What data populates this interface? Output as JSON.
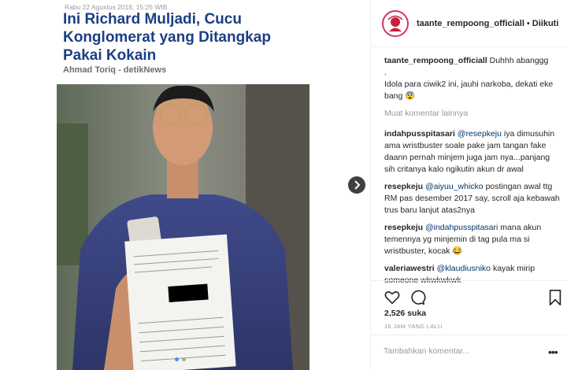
{
  "news": {
    "date": "Rabu 22 Agustus 2018, 15:25 WIB",
    "title": "Ini Richard Muljadi, Cucu Konglomerat yang Ditangkap Pakai Kokain",
    "author": "Ahmad Toriq - detikNews"
  },
  "post": {
    "username": "taante_rempoong_officiall",
    "separator": "•",
    "follow_status": "Diikuti"
  },
  "caption": {
    "user": "taante_rempoong_officiall",
    "lines": [
      "Duhhh abanggg",
      ".",
      "Idola para ciwik2 ini, jauhi narkoba, dekati eke bang 😨"
    ]
  },
  "load_more": "Muat komentar lainnya",
  "comments": [
    {
      "user": "indahpusspitasari",
      "mention": "@resepkeju",
      "text": "iya dimusuhin ama wristbuster soale pake jam tangan fake daann pernah minjem juga jam nya...panjang sih critanya kalo ngikutin akun dr awal"
    },
    {
      "user": "resepkeju",
      "mention": "@aiyuu_whicko",
      "text": "postingan awal ttg RM pas desember 2017 say, scroll aja kebawah trus baru lanjut atas2nya"
    },
    {
      "user": "resepkeju",
      "mention": "@indahpusspitasari",
      "text": "mana akun temennya yg minjemin di tag pula ma si wristbuster, kocak 😂"
    },
    {
      "user": "valeriawestri",
      "mention": "@klaudiusniko",
      "text": "kayak mirip someone wkwkwkwk"
    }
  ],
  "likes": "2,526 suka",
  "timestamp": "16 JAM YANG LALU",
  "add_comment_placeholder": "Tambahkan komentar...",
  "options_glyph": "•••",
  "colors": {
    "link": "#003569",
    "title": "#1b3f85",
    "accent": "#3897f0"
  }
}
